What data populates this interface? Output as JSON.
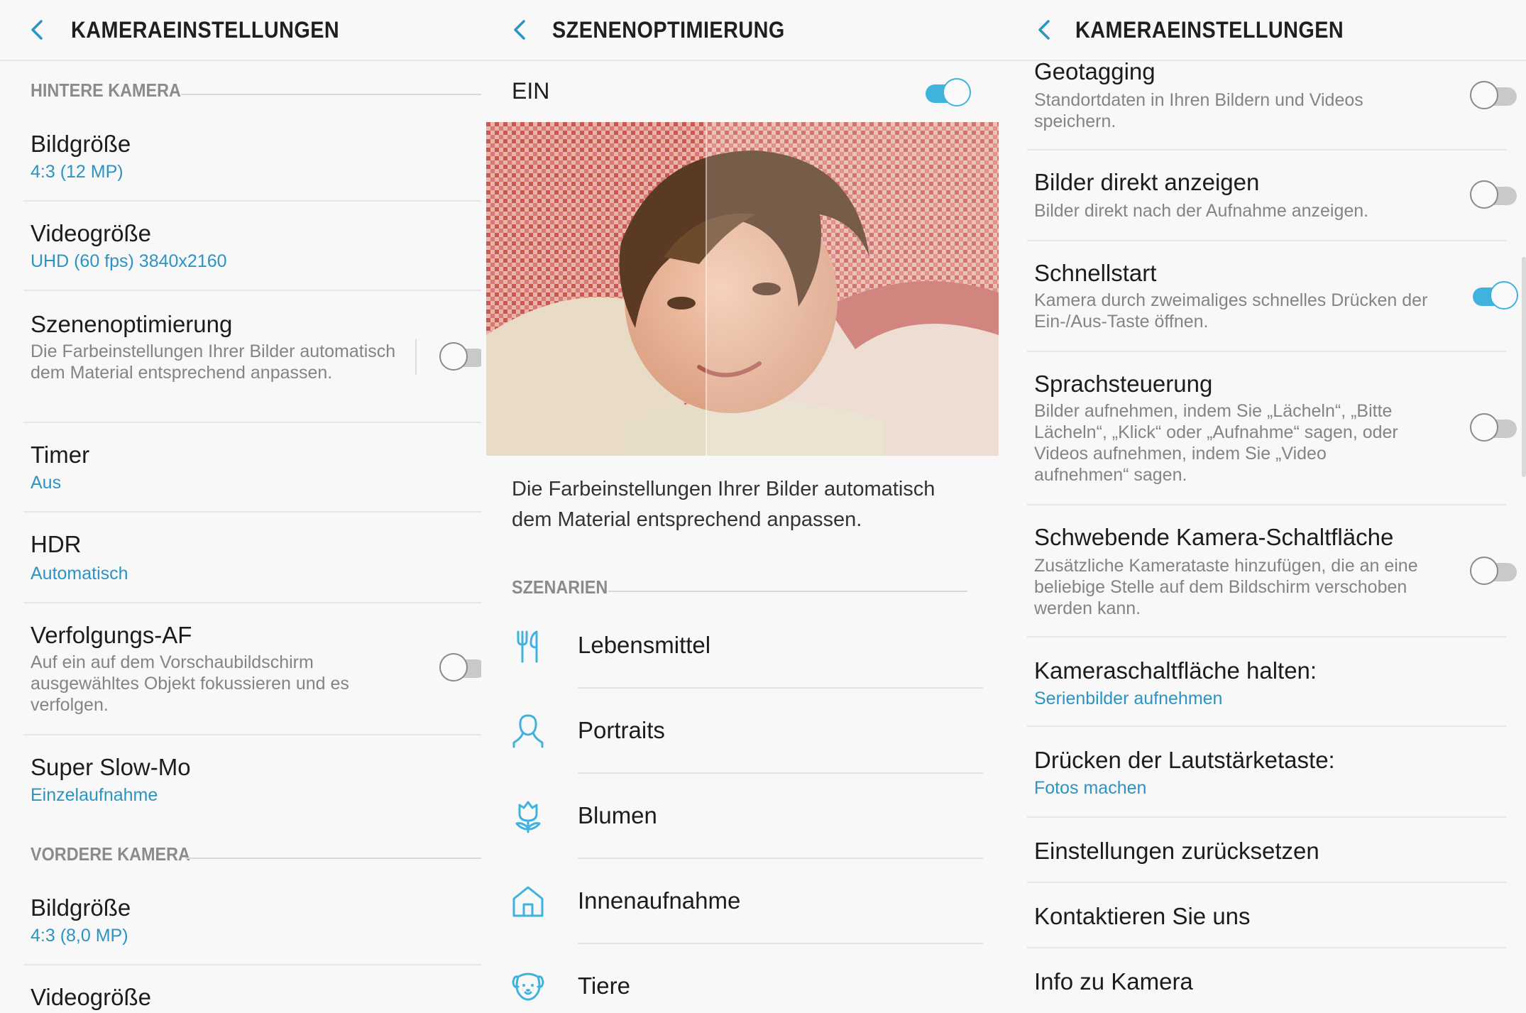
{
  "accent_color": "#3fb2de",
  "link_color": "#2b94c3",
  "panel1": {
    "title": "KAMERAEINSTELLUNGEN",
    "section_rear": "HINTERE KAMERA",
    "section_front": "VORDERE KAMERA",
    "items": [
      {
        "title": "Bildgröße",
        "value": "4:3 (12 MP)"
      },
      {
        "title": "Videogröße",
        "value": "UHD (60 fps) 3840x2160"
      },
      {
        "title": "Szenenoptimierung",
        "desc": "Die Farbeinstellungen Ihrer Bilder automatisch dem Material entsprechend anpassen.",
        "toggle": "off"
      },
      {
        "title": "Timer",
        "value": "Aus"
      },
      {
        "title": "HDR",
        "value": "Automatisch"
      },
      {
        "title": "Verfolgungs-AF",
        "desc": "Auf ein auf dem Vorschaubildschirm ausgewähltes Objekt fokussieren und es verfolgen.",
        "toggle": "off"
      },
      {
        "title": "Super Slow-Mo",
        "value": "Einzelaufnahme"
      }
    ],
    "front_items": [
      {
        "title": "Bildgröße",
        "value": "4:3 (8,0 MP)"
      },
      {
        "title": "Videogröße"
      }
    ]
  },
  "panel2": {
    "title": "SZENENOPTIMIERUNG",
    "master_label": "EIN",
    "master_toggle": "on",
    "description": "Die Farbeinstellungen Ihrer Bilder automatisch dem Material entsprechend anpassen.",
    "section": "SZENARIEN",
    "scenes": [
      {
        "label": "Lebensmittel",
        "icon": "fork-spoon-icon"
      },
      {
        "label": "Portraits",
        "icon": "person-icon"
      },
      {
        "label": "Blumen",
        "icon": "flower-icon"
      },
      {
        "label": "Innenaufnahme",
        "icon": "house-icon"
      },
      {
        "label": "Tiere",
        "icon": "dog-icon"
      }
    ]
  },
  "panel3": {
    "title": "KAMERAEINSTELLUNGEN",
    "items": [
      {
        "title": "Geotagging",
        "desc": "Standortdaten in Ihren Bildern und Videos speichern.",
        "toggle": "off"
      },
      {
        "title": "Bilder direkt anzeigen",
        "desc": "Bilder direkt nach der Aufnahme anzeigen.",
        "toggle": "off"
      },
      {
        "title": "Schnellstart",
        "desc": "Kamera durch zweimaliges schnelles Drücken der Ein-/Aus-Taste öffnen.",
        "toggle": "on"
      },
      {
        "title": "Sprachsteuerung",
        "desc": "Bilder aufnehmen, indem Sie „Lächeln“, „Bitte Lächeln“, „Klick“ oder „Aufnahme“ sagen, oder Videos aufnehmen, indem Sie „Video aufnehmen“ sagen.",
        "toggle": "off"
      },
      {
        "title": "Schwebende Kamera-Schaltfläche",
        "desc": "Zusätzliche Kamerataste hinzufügen, die an eine beliebige Stelle auf dem Bildschirm verschoben werden kann.",
        "toggle": "off"
      },
      {
        "title": "Kameraschaltfläche halten:",
        "value": "Serienbilder aufnehmen"
      },
      {
        "title": "Drücken der Lautstärketaste:",
        "value": "Fotos machen"
      },
      {
        "title": "Einstellungen zurücksetzen"
      },
      {
        "title": "Kontaktieren Sie uns"
      },
      {
        "title": "Info zu Kamera"
      }
    ]
  }
}
